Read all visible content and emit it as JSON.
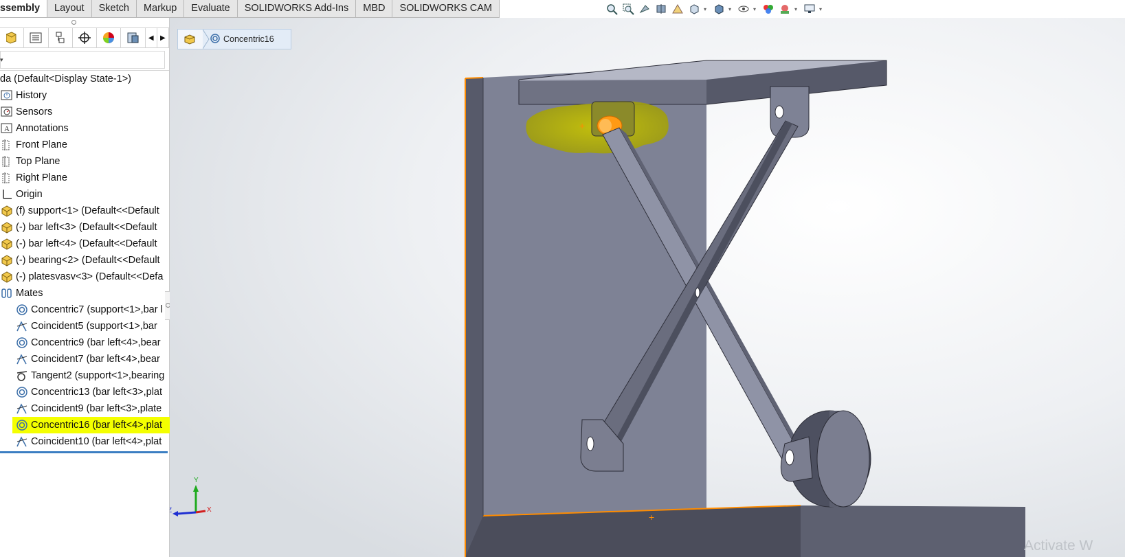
{
  "command_tabs": [
    "ssembly",
    "Layout",
    "Sketch",
    "Markup",
    "Evaluate",
    "SOLIDWORKS Add-Ins",
    "MBD",
    "SOLIDWORKS CAM"
  ],
  "active_tab_index": 0,
  "view_toolbar_icons": [
    "zoom-to-fit-icon",
    "zoom-to-area-icon",
    "previous-view-icon",
    "section-view-icon",
    "dynamic-annotation-icon",
    "view-orientation-icon",
    "display-style-icon",
    "hide-show-icon",
    "edit-appearance-icon",
    "apply-scene-icon",
    "view-settings-icon"
  ],
  "fm_tabs": [
    "featuremanager-tree-icon",
    "property-manager-icon",
    "configuration-manager-icon",
    "dimxpert-icon",
    "display-manager-icon",
    "cam-manager-icon"
  ],
  "tree": {
    "root": "da  (Default<Display State-1>)",
    "items": [
      {
        "label": "History",
        "icon": "history-icon"
      },
      {
        "label": "Sensors",
        "icon": "sensors-icon"
      },
      {
        "label": "Annotations",
        "icon": "annotations-icon"
      },
      {
        "label": "Front Plane",
        "icon": "plane-icon"
      },
      {
        "label": "Top Plane",
        "icon": "plane-icon"
      },
      {
        "label": "Right Plane",
        "icon": "plane-icon"
      },
      {
        "label": "Origin",
        "icon": "origin-icon"
      },
      {
        "label": "(f) support<1> (Default<<Default",
        "icon": "part-icon"
      },
      {
        "label": "(-) bar left<3> (Default<<Default",
        "icon": "part-icon"
      },
      {
        "label": "(-) bar left<4> (Default<<Default",
        "icon": "part-icon"
      },
      {
        "label": "(-) bearing<2> (Default<<Default",
        "icon": "part-icon"
      },
      {
        "label": "(-) platesvasv<3> (Default<<Defa",
        "icon": "part-icon"
      },
      {
        "label": "Mates",
        "icon": "mates-icon"
      }
    ],
    "mates": [
      {
        "label": "Concentric7 (support<1>,bar l",
        "icon": "concentric-icon"
      },
      {
        "label": "Coincident5 (support<1>,bar",
        "icon": "coincident-icon"
      },
      {
        "label": "Concentric9 (bar left<4>,bear",
        "icon": "concentric-icon"
      },
      {
        "label": "Coincident7 (bar left<4>,bear",
        "icon": "coincident-icon"
      },
      {
        "label": "Tangent2 (support<1>,bearing",
        "icon": "tangent-icon"
      },
      {
        "label": "Concentric13 (bar left<3>,plat",
        "icon": "concentric-icon"
      },
      {
        "label": "Coincident9 (bar left<3>,plate",
        "icon": "coincident-icon"
      },
      {
        "label": "Concentric16 (bar left<4>,plat",
        "icon": "concentric-icon",
        "selected": true
      },
      {
        "label": "Coincident10 (bar left<4>,plat",
        "icon": "coincident-icon"
      }
    ]
  },
  "breadcrumb": {
    "label": "Concentric16"
  },
  "triad": {
    "x": "X",
    "y": "Y",
    "z": "Z"
  },
  "watermark": "Activate W",
  "colors": {
    "selection": "#f4ff00",
    "highlight": "#b3b300",
    "edge_highlight": "#ff8c00",
    "model_face": "#7e8295",
    "model_dark": "#4b4d5b",
    "model_top": "#9699aa",
    "tree_end_bar": "#3b7ec2"
  }
}
